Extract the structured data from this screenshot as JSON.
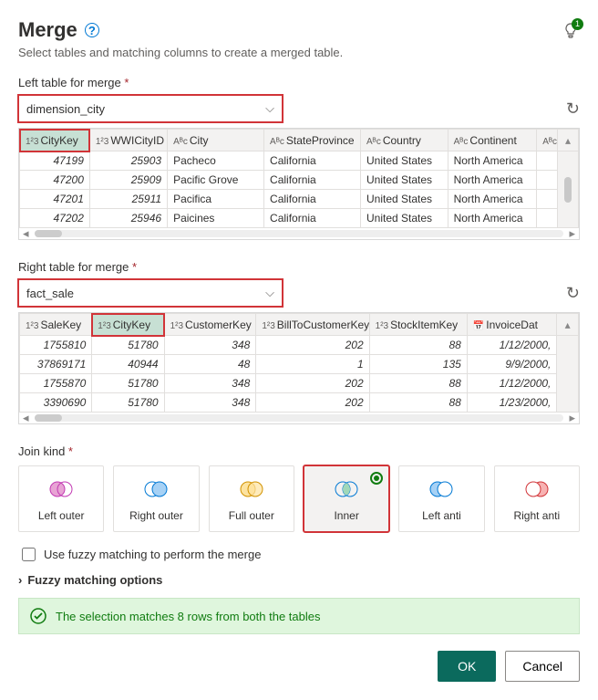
{
  "header": {
    "title": "Merge",
    "subtitle": "Select tables and matching columns to create a merged table.",
    "notif_count": "1"
  },
  "left": {
    "label": "Left table for merge",
    "dropdown_value": "dimension_city",
    "columns": {
      "c0": "CityKey",
      "c1": "WWICityID",
      "c2": "City",
      "c3": "StateProvince",
      "c4": "Country",
      "c5": "Continent"
    },
    "rows": [
      {
        "c0": "47199",
        "c1": "25903",
        "c2": "Pacheco",
        "c3": "California",
        "c4": "United States",
        "c5": "North America"
      },
      {
        "c0": "47200",
        "c1": "25909",
        "c2": "Pacific Grove",
        "c3": "California",
        "c4": "United States",
        "c5": "North America"
      },
      {
        "c0": "47201",
        "c1": "25911",
        "c2": "Pacifica",
        "c3": "California",
        "c4": "United States",
        "c5": "North America"
      },
      {
        "c0": "47202",
        "c1": "25946",
        "c2": "Paicines",
        "c3": "California",
        "c4": "United States",
        "c5": "North America"
      }
    ]
  },
  "right": {
    "label": "Right table for merge",
    "dropdown_value": "fact_sale",
    "columns": {
      "c0": "SaleKey",
      "c1": "CityKey",
      "c2": "CustomerKey",
      "c3": "BillToCustomerKey",
      "c4": "StockItemKey",
      "c5": "InvoiceDat"
    },
    "rows": [
      {
        "c0": "1755810",
        "c1": "51780",
        "c2": "348",
        "c3": "202",
        "c4": "88",
        "c5": "1/12/2000,"
      },
      {
        "c0": "37869171",
        "c1": "40944",
        "c2": "48",
        "c3": "1",
        "c4": "135",
        "c5": "9/9/2000,"
      },
      {
        "c0": "1755870",
        "c1": "51780",
        "c2": "348",
        "c3": "202",
        "c4": "88",
        "c5": "1/12/2000,"
      },
      {
        "c0": "3390690",
        "c1": "51780",
        "c2": "348",
        "c3": "202",
        "c4": "88",
        "c5": "1/23/2000,"
      }
    ]
  },
  "join": {
    "label": "Join kind",
    "options": {
      "o0": "Left outer",
      "o1": "Right outer",
      "o2": "Full outer",
      "o3": "Inner",
      "o4": "Left anti",
      "o5": "Right anti"
    }
  },
  "fuzzy": {
    "checkbox": "Use fuzzy matching to perform the merge",
    "expander": "Fuzzy matching options"
  },
  "status": {
    "message": "The selection matches 8 rows from both the tables"
  },
  "buttons": {
    "ok": "OK",
    "cancel": "Cancel"
  }
}
